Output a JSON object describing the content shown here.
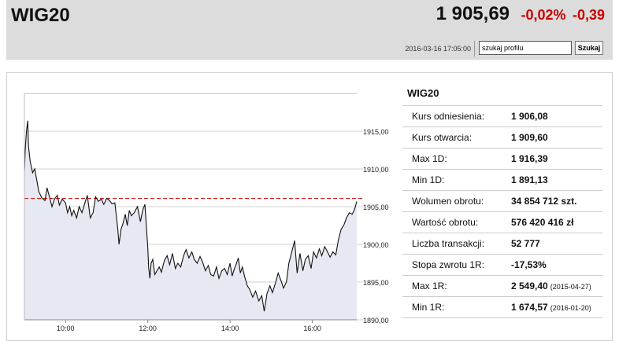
{
  "header": {
    "title": "WIG20",
    "price": "1 905,69",
    "change_pct": "-0,02%",
    "change_abs": "-0,39",
    "datetime": "2016-03-16 17:05:00",
    "search_value": "szukaj profilu",
    "search_button": "Szukaj"
  },
  "colors": {
    "negative": "#cc0000",
    "header_bg": "#dcdcdc",
    "chart_fill": "#e6e9f2",
    "reference_line": "#cc0000"
  },
  "chart_data": {
    "type": "area",
    "x_tick_labels": [
      "10:00",
      "12:00",
      "14:00",
      "16:00"
    ],
    "x_range_hours": [
      9.0,
      17.08
    ],
    "y_tick_labels": [
      "1915,00",
      "1910,00",
      "1905,00",
      "1900,00",
      "1895,00",
      "1890,00"
    ],
    "y_ticks": [
      1915,
      1910,
      1905,
      1900,
      1895,
      1890
    ],
    "ylim": [
      1890,
      1920
    ],
    "grid": true,
    "reference_value": 1906.08,
    "series": [
      {
        "x": [
          9.0,
          9.02,
          9.05,
          9.08,
          9.1,
          9.14,
          9.2,
          9.25,
          9.3,
          9.35,
          9.42,
          9.5,
          9.55,
          9.6,
          9.67,
          9.73,
          9.8,
          9.85,
          9.92,
          10.0,
          10.05,
          10.1,
          10.15,
          10.2,
          10.27,
          10.33,
          10.4,
          10.47,
          10.53,
          10.6,
          10.67,
          10.73,
          10.8,
          10.87,
          10.93,
          11.0,
          11.07,
          11.13,
          11.2,
          11.27,
          11.3,
          11.35,
          11.4,
          11.45,
          11.5,
          11.55,
          11.6,
          11.67,
          11.75,
          11.82,
          11.88,
          11.93,
          12.0,
          12.02,
          12.05,
          12.08,
          12.12,
          12.17,
          12.22,
          12.28,
          12.33,
          12.4,
          12.47,
          12.53,
          12.6,
          12.67,
          12.73,
          12.8,
          12.87,
          12.93,
          13.0,
          13.07,
          13.13,
          13.2,
          13.27,
          13.33,
          13.4,
          13.47,
          13.53,
          13.6,
          13.67,
          13.73,
          13.8,
          13.87,
          13.93,
          14.0,
          14.05,
          14.1,
          14.15,
          14.2,
          14.25,
          14.3,
          14.35,
          14.42,
          14.48,
          14.55,
          14.62,
          14.7,
          14.77,
          14.83,
          14.9,
          14.97,
          15.03,
          15.1,
          15.17,
          15.23,
          15.3,
          15.37,
          15.43,
          15.5,
          15.57,
          15.63,
          15.7,
          15.77,
          15.83,
          15.9,
          15.97,
          16.03,
          16.1,
          16.17,
          16.23,
          16.3,
          16.37,
          16.43,
          16.5,
          16.57,
          16.63,
          16.7,
          16.77,
          16.83,
          16.9,
          16.97,
          17.03,
          17.08
        ],
        "values": [
          1909.6,
          1912.5,
          1915.0,
          1916.39,
          1913.0,
          1911.0,
          1909.5,
          1910.0,
          1908.5,
          1907.0,
          1906.2,
          1905.8,
          1907.5,
          1906.5,
          1905.0,
          1906.0,
          1906.5,
          1905.2,
          1906.0,
          1905.5,
          1904.2,
          1905.0,
          1903.8,
          1904.5,
          1903.5,
          1905.0,
          1904.2,
          1905.5,
          1906.5,
          1903.5,
          1904.2,
          1906.3,
          1905.7,
          1906.0,
          1905.3,
          1906.1,
          1905.8,
          1905.4,
          1905.5,
          1902.0,
          1900.0,
          1902.0,
          1902.8,
          1904.0,
          1902.5,
          1904.5,
          1903.8,
          1904.2,
          1905.0,
          1903.0,
          1904.6,
          1905.3,
          1899.5,
          1897.0,
          1895.5,
          1897.5,
          1898.0,
          1896.0,
          1896.5,
          1897.0,
          1896.3,
          1897.8,
          1898.5,
          1897.3,
          1898.8,
          1896.8,
          1897.5,
          1897.0,
          1898.5,
          1899.3,
          1898.2,
          1899.0,
          1898.0,
          1897.5,
          1898.4,
          1897.7,
          1896.5,
          1897.2,
          1896.0,
          1895.8,
          1897.0,
          1895.5,
          1896.5,
          1896.8,
          1896.0,
          1897.5,
          1895.8,
          1896.7,
          1897.4,
          1898.2,
          1896.2,
          1897.0,
          1895.8,
          1894.5,
          1894.0,
          1893.0,
          1893.8,
          1892.5,
          1893.2,
          1891.13,
          1893.5,
          1894.5,
          1893.6,
          1894.8,
          1896.2,
          1895.3,
          1894.2,
          1895.0,
          1897.5,
          1899.0,
          1900.5,
          1896.2,
          1898.8,
          1896.5,
          1898.0,
          1898.5,
          1896.8,
          1899.0,
          1898.2,
          1899.4,
          1898.5,
          1899.7,
          1899.0,
          1898.3,
          1899.0,
          1898.6,
          1900.5,
          1902.0,
          1902.6,
          1903.5,
          1904.2,
          1904.0,
          1904.7,
          1905.69
        ]
      }
    ]
  },
  "stats": {
    "title": "WIG20",
    "rows": [
      {
        "label": "Kurs odniesienia:",
        "value": "1 906,08",
        "date": ""
      },
      {
        "label": "Kurs otwarcia:",
        "value": "1 909,60",
        "date": ""
      },
      {
        "label": "Max 1D:",
        "value": "1 916,39",
        "date": ""
      },
      {
        "label": "Min 1D:",
        "value": "1 891,13",
        "date": ""
      },
      {
        "label": "Wolumen obrotu:",
        "value": "34 854 712 szt.",
        "date": ""
      },
      {
        "label": "Wartość obrotu:",
        "value": "576 420 416 zł",
        "date": ""
      },
      {
        "label": "Liczba transakcji:",
        "value": "52 777",
        "date": ""
      },
      {
        "label": "Stopa zwrotu 1R:",
        "value": "-17,53%",
        "date": ""
      },
      {
        "label": "Max 1R:",
        "value": "2 549,40",
        "date": "(2015-04-27)"
      },
      {
        "label": "Min 1R:",
        "value": "1 674,57",
        "date": "(2016-01-20)"
      }
    ]
  }
}
